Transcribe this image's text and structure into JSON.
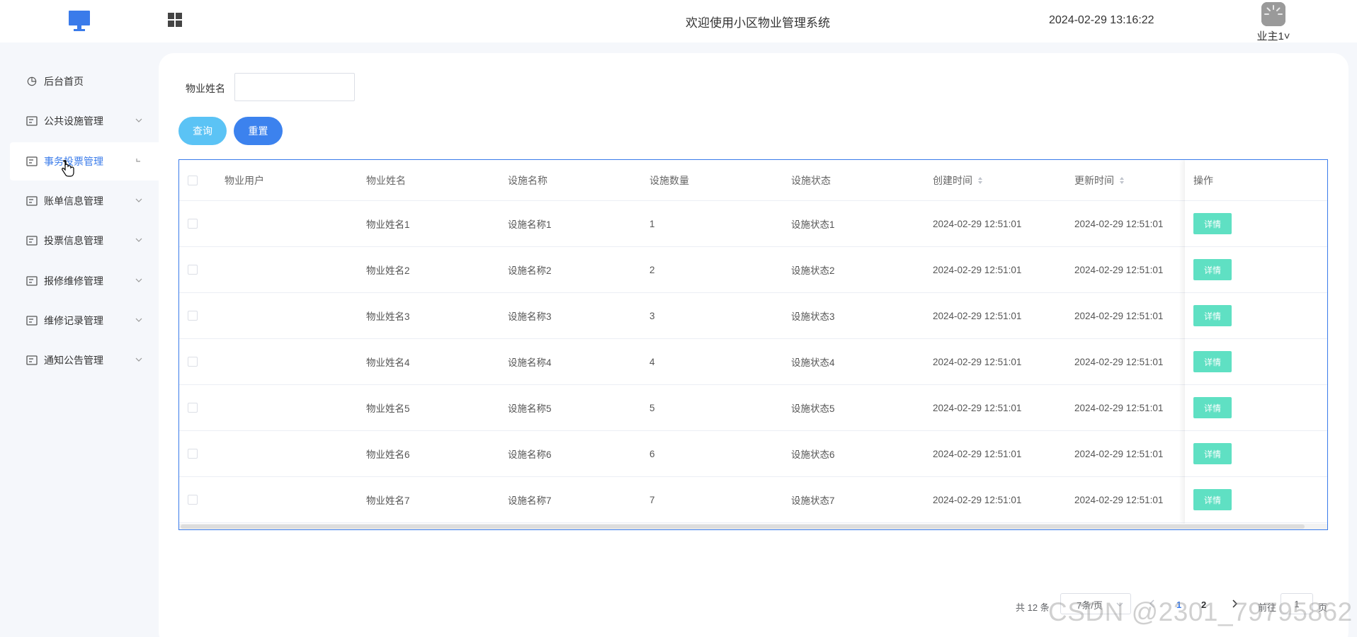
{
  "header": {
    "title": "欢迎使用小区物业管理系统",
    "datetime": "2024-02-29 13:16:22",
    "user_name": "业主1",
    "user_caret": "˅",
    "colors": {
      "logo": "#3a7bea",
      "accent": "#3a7bea"
    }
  },
  "sidebar": {
    "items": [
      {
        "label": "后台首页",
        "icon": "clock-pie-icon",
        "has_chevron": false
      },
      {
        "label": "公共设施管理",
        "icon": "card-icon",
        "has_chevron": true
      },
      {
        "label": "事务投票管理",
        "icon": "card-icon",
        "has_chevron": true,
        "active": true
      },
      {
        "label": "账单信息管理",
        "icon": "card-icon",
        "has_chevron": true
      },
      {
        "label": "投票信息管理",
        "icon": "card-icon",
        "has_chevron": true
      },
      {
        "label": "报修维修管理",
        "icon": "card-icon",
        "has_chevron": true
      },
      {
        "label": "维修记录管理",
        "icon": "card-icon",
        "has_chevron": true
      },
      {
        "label": "通知公告管理",
        "icon": "card-icon",
        "has_chevron": true
      }
    ]
  },
  "search": {
    "label": "物业姓名",
    "value": "",
    "placeholder": "",
    "query_label": "查询",
    "reset_label": "重置",
    "colors": {
      "query": "#5bc3f5",
      "reset": "#3c82ee"
    }
  },
  "table": {
    "columns": [
      "物业用户",
      "物业姓名",
      "设施名称",
      "设施数量",
      "设施状态",
      "创建时间",
      "更新时间",
      "操作"
    ],
    "sortable_columns": [
      "创建时间",
      "更新时间"
    ],
    "detail_label": "详情",
    "detail_color": "#5fe0c3",
    "rows": [
      {
        "user": "",
        "name": "物业姓名1",
        "facility": "设施名称1",
        "qty": "1",
        "status": "设施状态1",
        "created": "2024-02-29 12:51:01",
        "updated": "2024-02-29 12:51:01"
      },
      {
        "user": "",
        "name": "物业姓名2",
        "facility": "设施名称2",
        "qty": "2",
        "status": "设施状态2",
        "created": "2024-02-29 12:51:01",
        "updated": "2024-02-29 12:51:01"
      },
      {
        "user": "",
        "name": "物业姓名3",
        "facility": "设施名称3",
        "qty": "3",
        "status": "设施状态3",
        "created": "2024-02-29 12:51:01",
        "updated": "2024-02-29 12:51:01"
      },
      {
        "user": "",
        "name": "物业姓名4",
        "facility": "设施名称4",
        "qty": "4",
        "status": "设施状态4",
        "created": "2024-02-29 12:51:01",
        "updated": "2024-02-29 12:51:01"
      },
      {
        "user": "",
        "name": "物业姓名5",
        "facility": "设施名称5",
        "qty": "5",
        "status": "设施状态5",
        "created": "2024-02-29 12:51:01",
        "updated": "2024-02-29 12:51:01"
      },
      {
        "user": "",
        "name": "物业姓名6",
        "facility": "设施名称6",
        "qty": "6",
        "status": "设施状态6",
        "created": "2024-02-29 12:51:01",
        "updated": "2024-02-29 12:51:01"
      },
      {
        "user": "",
        "name": "物业姓名7",
        "facility": "设施名称7",
        "qty": "7",
        "status": "设施状态7",
        "created": "2024-02-29 12:51:01",
        "updated": "2024-02-29 12:51:01"
      }
    ]
  },
  "pagination": {
    "total_text": "共 12 条",
    "page_size": "7条/页",
    "pages": [
      "1",
      "2"
    ],
    "current_page": "1",
    "goto_label": "前往",
    "goto_value": "1",
    "page_suffix": "页"
  },
  "watermark": "CSDN @2301_79795862"
}
